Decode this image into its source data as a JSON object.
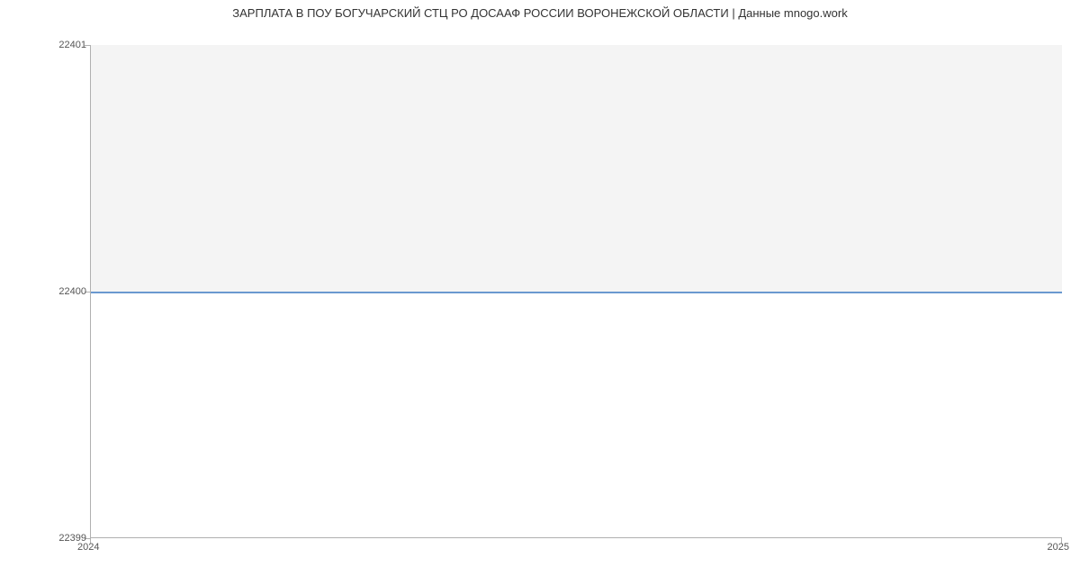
{
  "chart_data": {
    "type": "area",
    "title": "ЗАРПЛАТА В ПОУ БОГУЧАРСКИЙ СТЦ РО ДОСААФ РОССИИ ВОРОНЕЖСКОЙ ОБЛАСТИ | Данные mnogo.work",
    "xlabel": "",
    "ylabel": "",
    "x": [
      2024,
      2025
    ],
    "values": [
      22400,
      22400
    ],
    "x_ticks": [
      "2024",
      "2025"
    ],
    "y_ticks": [
      "22399",
      "22400",
      "22401"
    ],
    "ylim": [
      22399,
      22401
    ],
    "xlim": [
      2024,
      2025
    ]
  }
}
